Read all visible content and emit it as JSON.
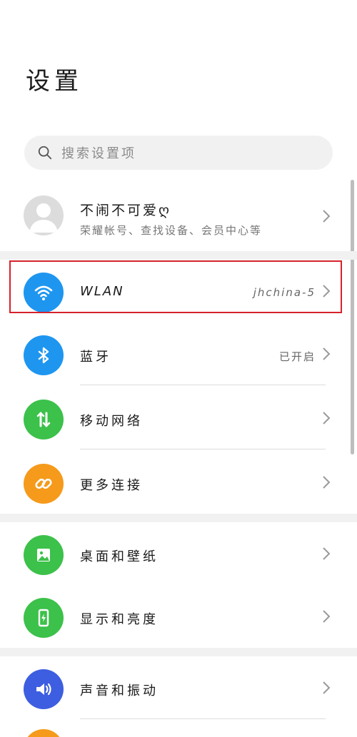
{
  "header": {
    "title": "设置"
  },
  "search": {
    "placeholder": "搜索设置项"
  },
  "account": {
    "name": "不闹不可爱ღ",
    "subtitle": "荣耀帐号、查找设备、会员中心等"
  },
  "group1": [
    {
      "label": "WLAN",
      "value": "jhchina-5",
      "icon": "wifi-icon",
      "color": "#1e96f0"
    },
    {
      "label": "蓝牙",
      "value": "已开启",
      "icon": "bluetooth-icon",
      "color": "#1e96f0"
    },
    {
      "label": "移动网络",
      "value": "",
      "icon": "mobile-data-icon",
      "color": "#3cc14a"
    },
    {
      "label": "更多连接",
      "value": "",
      "icon": "link-icon",
      "color": "#f59a1b"
    }
  ],
  "group2": [
    {
      "label": "桌面和壁纸",
      "icon": "wallpaper-icon",
      "color": "#3cc14a"
    },
    {
      "label": "显示和亮度",
      "icon": "display-brightness-icon",
      "color": "#3cc14a"
    }
  ],
  "group3": [
    {
      "label": "声音和振动",
      "icon": "speaker-icon",
      "color": "#3d5ee0"
    }
  ],
  "colors": {
    "highlight": "#d6222a",
    "section_gap": "#f1f1f1"
  }
}
